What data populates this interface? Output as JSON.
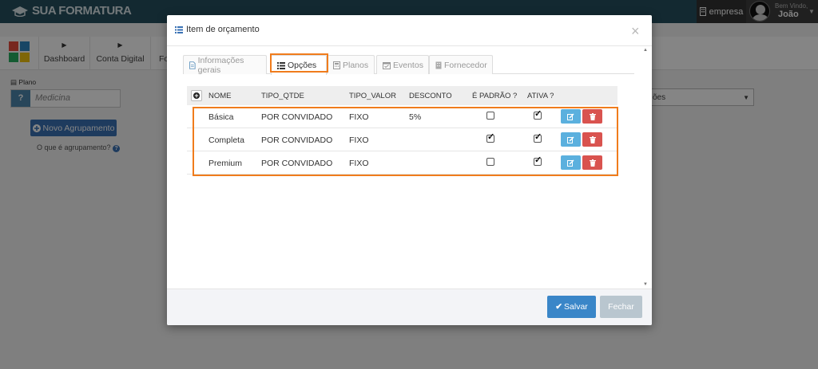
{
  "header": {
    "logo_text": "SUA FORMATURA",
    "empresa_label": "empresa",
    "welcome_text": "Bem Vindo,",
    "user_name": "João"
  },
  "nav": {
    "items": [
      {
        "label": "Dashboard"
      },
      {
        "label": "Conta Digital"
      },
      {
        "label": "Fo"
      }
    ]
  },
  "left_panel": {
    "plano_label": "Plano",
    "plano_value": "Medicina",
    "help_icon_text": "?",
    "novo_button": "Novo Agrupamento",
    "help_link": "O que é agrupamento?"
  },
  "right_select": {
    "value": "ões"
  },
  "modal": {
    "title": "Item de orçamento",
    "close_symbol": "×",
    "tabs": [
      {
        "label": "Informações gerais",
        "icon": "document-icon"
      },
      {
        "label": "Opções",
        "icon": "list-icon",
        "active": true
      },
      {
        "label": "Planos",
        "icon": "calculator-icon"
      },
      {
        "label": "Eventos",
        "icon": "calendar-icon"
      },
      {
        "label": "Fornecedor",
        "icon": "building-icon"
      }
    ],
    "table": {
      "add_symbol": "+",
      "columns": [
        "NOME",
        "TIPO_QTDE",
        "TIPO_VALOR",
        "DESCONTO",
        "É PADRÃO ?",
        "ATIVA ?"
      ],
      "rows": [
        {
          "nome": "Básica",
          "tipo_qtde": "POR CONVIDADO",
          "tipo_valor": "FIXO",
          "desconto": "5%",
          "padrao": false,
          "ativa": true
        },
        {
          "nome": "Completa",
          "tipo_qtde": "POR CONVIDADO",
          "tipo_valor": "FIXO",
          "desconto": "",
          "padrao": true,
          "ativa": true
        },
        {
          "nome": "Premium",
          "tipo_qtde": "POR CONVIDADO",
          "tipo_valor": "FIXO",
          "desconto": "",
          "padrao": false,
          "ativa": true
        }
      ]
    },
    "footer": {
      "save_label": "Salvar",
      "close_label": "Fechar"
    }
  },
  "colors": {
    "highlight": "#f07c1c",
    "primary": "#3a86c8",
    "danger": "#d9534f",
    "info": "#5bb0de",
    "topbar": "#25505f"
  }
}
